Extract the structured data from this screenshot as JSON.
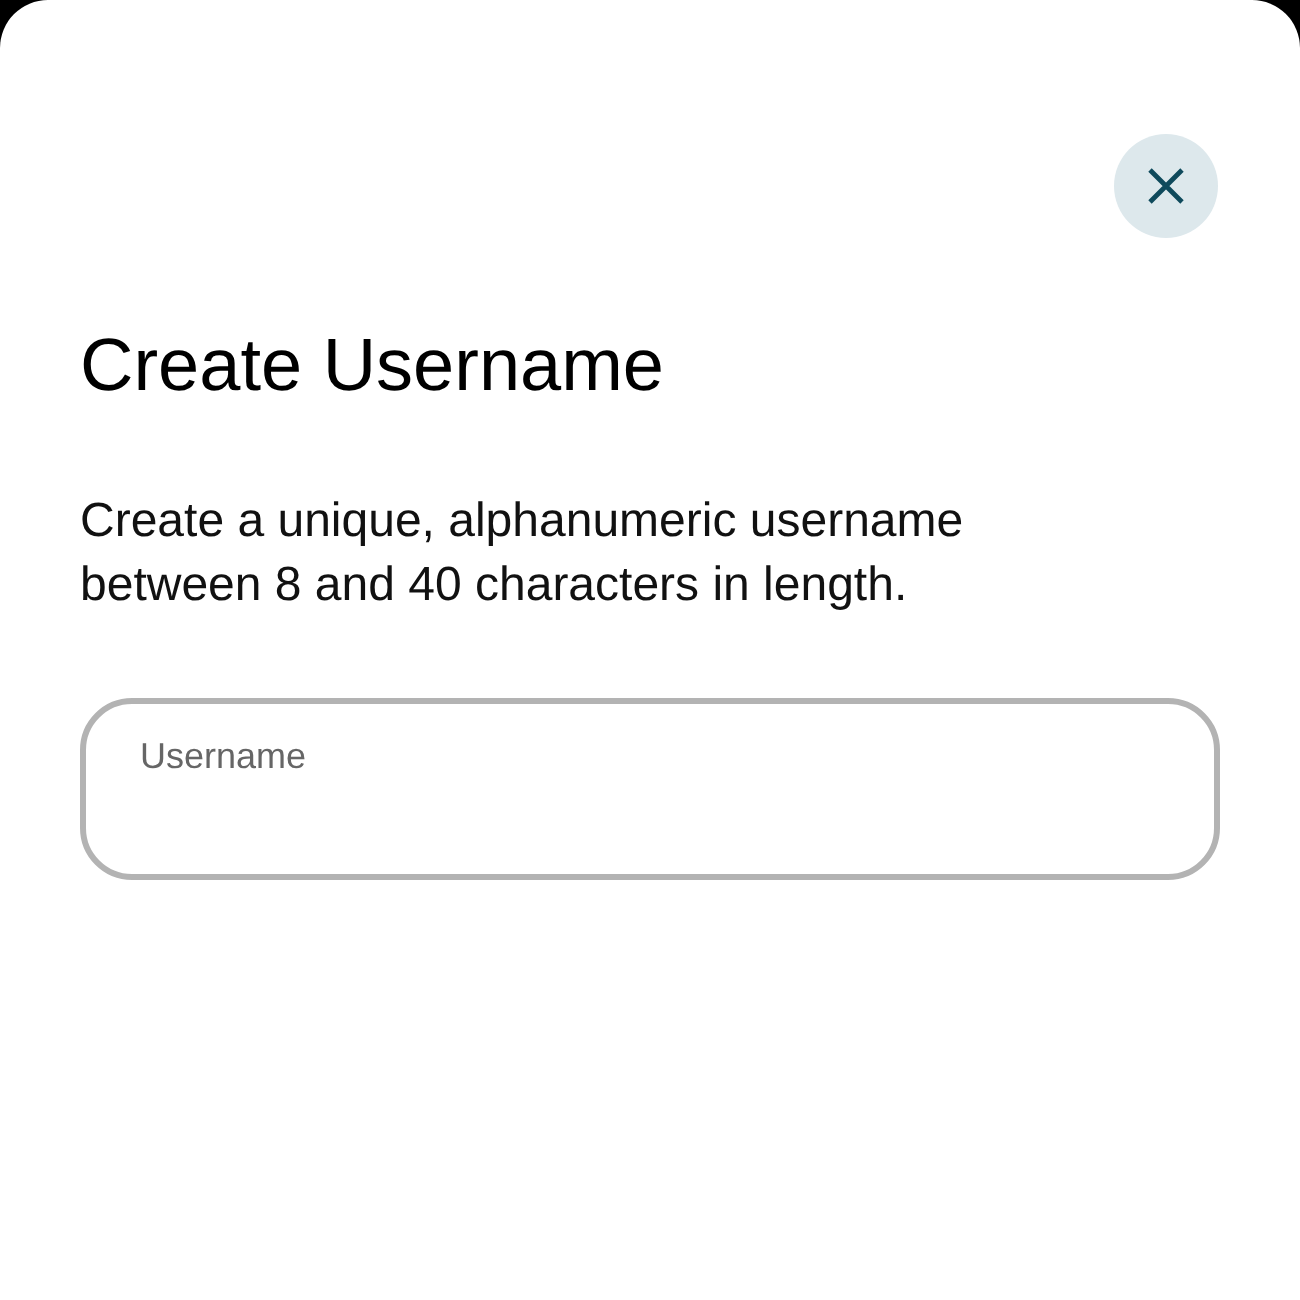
{
  "dialog": {
    "title": "Create Username",
    "description": "Create a unique, alphanumeric username between 8 and 40 characters in length.",
    "field": {
      "label": "Username"
    }
  }
}
